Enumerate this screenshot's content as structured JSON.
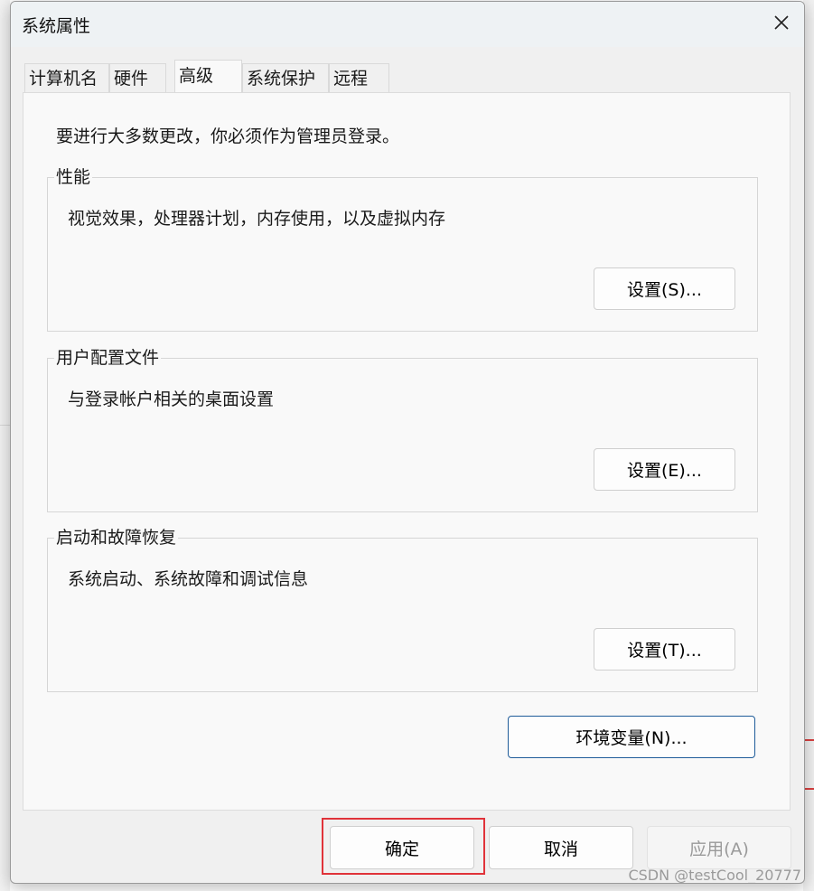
{
  "window": {
    "title": "系统属性"
  },
  "tabs": [
    {
      "label": "计算机名"
    },
    {
      "label": "硬件"
    },
    {
      "label": "高级"
    },
    {
      "label": "系统保护"
    },
    {
      "label": "远程"
    }
  ],
  "active_tab": "高级",
  "admin_note": "要进行大多数更改，你必须作为管理员登录。",
  "groups": {
    "performance": {
      "title": "性能",
      "description": "视觉效果，处理器计划，内存使用，以及虚拟内存",
      "button": "设置(S)..."
    },
    "user_profiles": {
      "title": "用户配置文件",
      "description": "与登录帐户相关的桌面设置",
      "button": "设置(E)..."
    },
    "startup_recovery": {
      "title": "启动和故障恢复",
      "description": "系统启动、系统故障和调试信息",
      "button": "设置(T)..."
    }
  },
  "env_button": "环境变量(N)...",
  "footer": {
    "ok": "确定",
    "cancel": "取消",
    "apply": "应用(A)"
  },
  "watermark": "CSDN @testCool_20777",
  "colors": {
    "highlight_box": "#e0333a",
    "focus_border": "#1f5c99",
    "disabled_text": "#9a9a9a"
  },
  "icons": {
    "close": "close-icon"
  }
}
